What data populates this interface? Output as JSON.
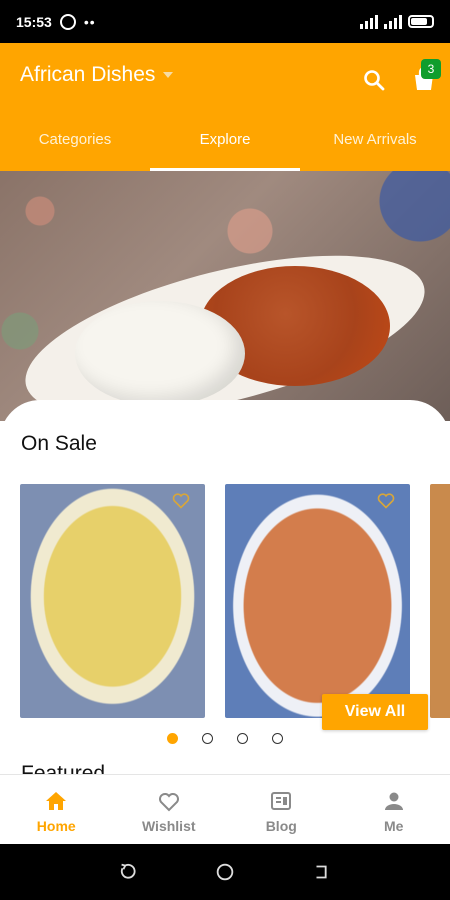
{
  "status_bar": {
    "time": "15:53",
    "icons": [
      "whatsapp-icon",
      "more-dots-icon",
      "signal-icon",
      "battery-icon"
    ]
  },
  "app_bar": {
    "title": "African Dishes",
    "cart_count": "3",
    "tabs": [
      {
        "label": "Categories",
        "active": false
      },
      {
        "label": "Explore",
        "active": true
      },
      {
        "label": "New Arrivals",
        "active": false
      }
    ]
  },
  "on_sale": {
    "title": "On Sale",
    "view_all_label": "View All",
    "carousel_dots": 4,
    "active_dot": 0
  },
  "featured": {
    "title": "Featured"
  },
  "bottom_nav": {
    "items": [
      {
        "label": "Home",
        "icon": "home-icon",
        "active": true
      },
      {
        "label": "Wishlist",
        "icon": "heart-icon",
        "active": false
      },
      {
        "label": "Blog",
        "icon": "blog-icon",
        "active": false
      },
      {
        "label": "Me",
        "icon": "person-icon",
        "active": false
      }
    ]
  },
  "colors": {
    "accent": "#FFA500",
    "badge": "#0F9D2D",
    "nav_inactive": "#8A8A8A"
  }
}
